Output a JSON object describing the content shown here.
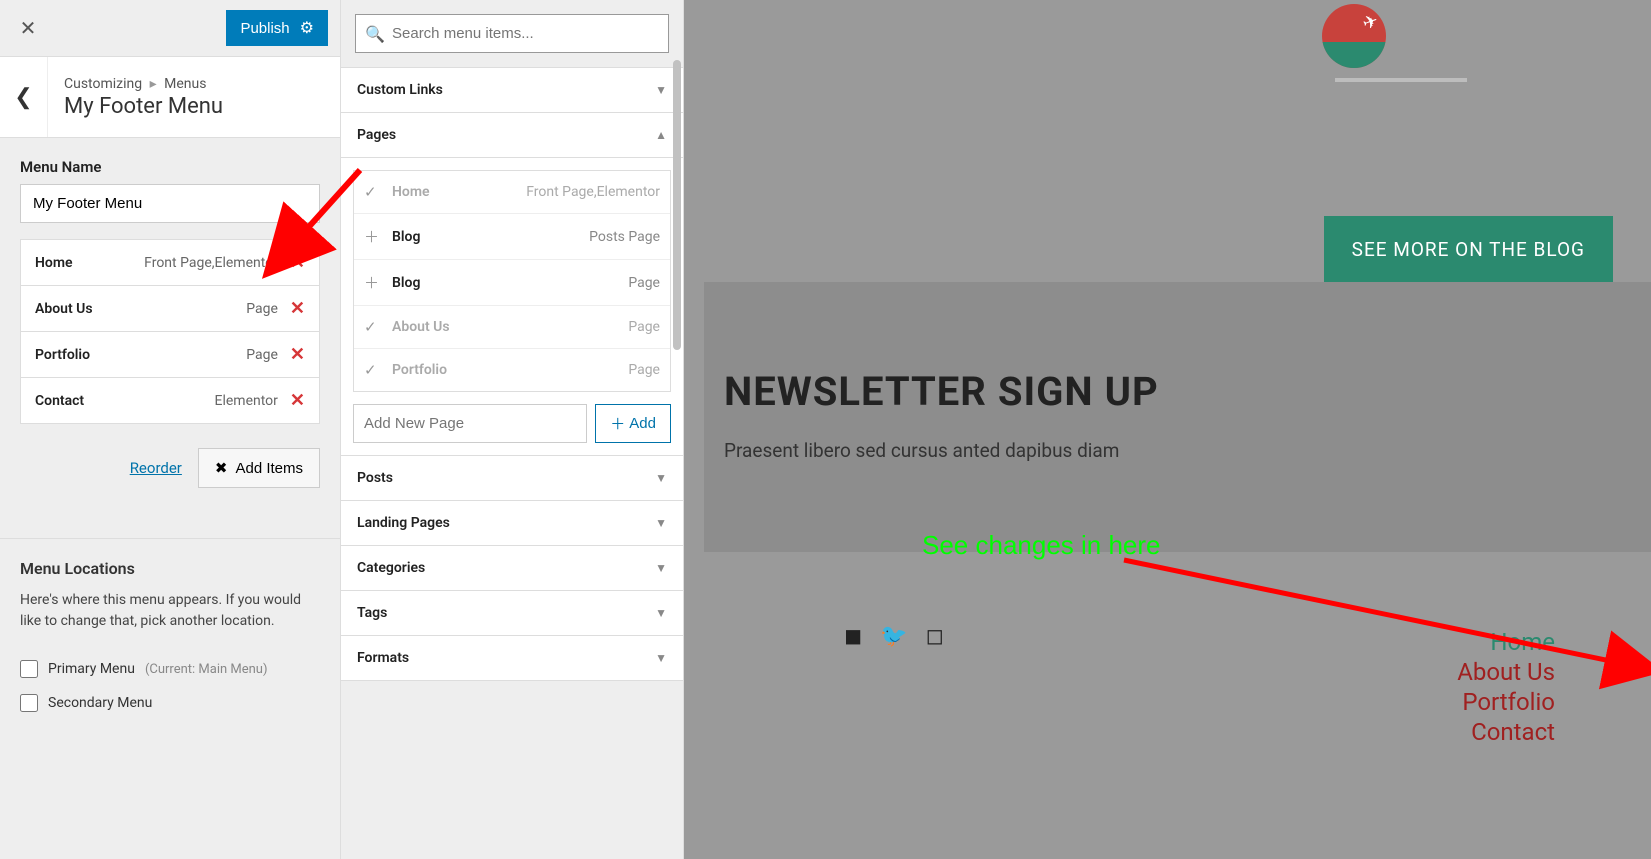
{
  "topbar": {
    "publish_label": "Publish"
  },
  "header": {
    "breadcrumb_root": "Customizing",
    "breadcrumb_leaf": "Menus",
    "title": "My Footer Menu"
  },
  "menu_name": {
    "label": "Menu Name",
    "value": "My Footer Menu"
  },
  "menu_items": [
    {
      "name": "Home",
      "meta": "Front Page,Elementor"
    },
    {
      "name": "About Us",
      "meta": "Page"
    },
    {
      "name": "Portfolio",
      "meta": "Page"
    },
    {
      "name": "Contact",
      "meta": "Elementor"
    }
  ],
  "actions": {
    "reorder": "Reorder",
    "add_items": "Add Items"
  },
  "locations": {
    "title": "Menu Locations",
    "desc": "Here's where this menu appears. If you would like to change that, pick another location.",
    "options": [
      {
        "label": "Primary Menu",
        "hint": "(Current: Main Menu)"
      },
      {
        "label": "Secondary Menu",
        "hint": ""
      }
    ]
  },
  "items_panel": {
    "search_placeholder": "Search menu items...",
    "sections": {
      "custom_links": "Custom Links",
      "pages": "Pages",
      "posts": "Posts",
      "landing_pages": "Landing Pages",
      "categories": "Categories",
      "tags": "Tags",
      "formats": "Formats"
    },
    "pages_list": [
      {
        "name": "Home",
        "meta": "Front Page,Elementor",
        "added": true
      },
      {
        "name": "Blog",
        "meta": "Posts Page",
        "added": false
      },
      {
        "name": "Blog",
        "meta": "Page",
        "added": false
      },
      {
        "name": "About Us",
        "meta": "Page",
        "added": true
      },
      {
        "name": "Portfolio",
        "meta": "Page",
        "added": true
      }
    ],
    "new_page_placeholder": "Add New Page",
    "add_label": "Add"
  },
  "preview": {
    "see_more": "SEE MORE ON THE BLOG",
    "newsletter_title": "NEWSLETTER SIGN UP",
    "newsletter_sub": "Praesent libero sed cursus anted dapibus diam",
    "annotation": "See changes in here",
    "footer_nav": [
      "Home",
      "About Us",
      "Portfolio",
      "Contact"
    ]
  }
}
